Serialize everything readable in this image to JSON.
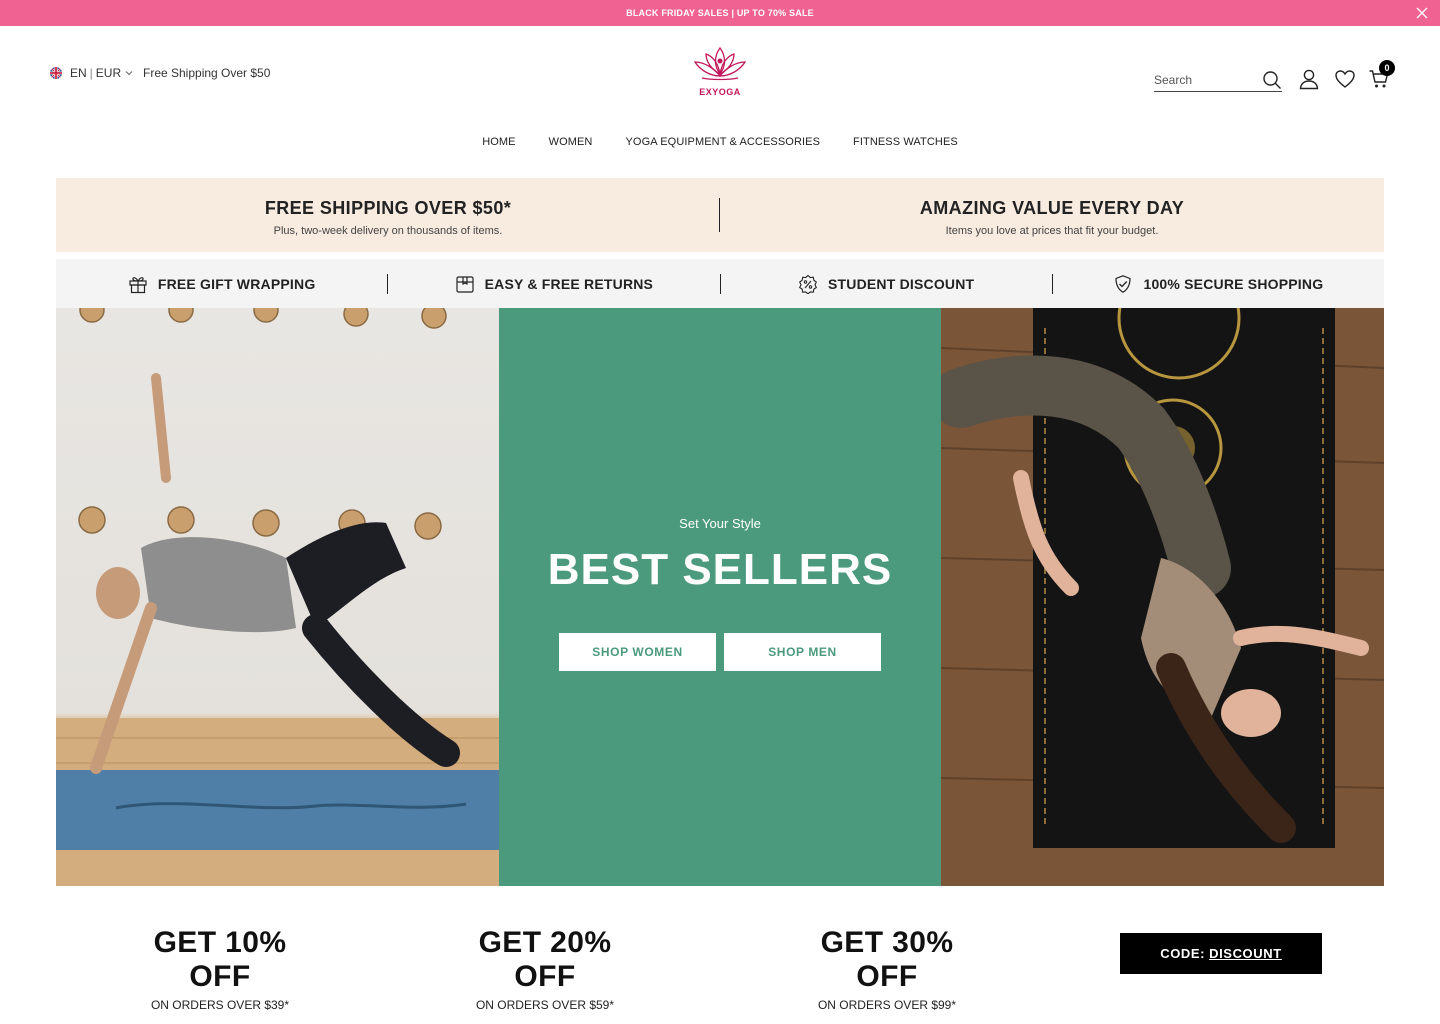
{
  "announcement": {
    "text": "BLACK FRIDAY SALES | UP TO 70% SALE"
  },
  "header": {
    "language": "EN",
    "currency": "EUR",
    "free_shipping": "Free Shipping Over $50",
    "logo_text": "EXYOGA",
    "search_placeholder": "Search",
    "cart_count": "0",
    "brand_color": "#c2185b"
  },
  "nav": {
    "items": [
      {
        "label": "HOME"
      },
      {
        "label": "WOMEN"
      },
      {
        "label": "YOGA EQUIPMENT & ACCESSORIES"
      },
      {
        "label": "FITNESS WATCHES"
      }
    ]
  },
  "promo": {
    "left": {
      "title": "FREE SHIPPING OVER $50*",
      "subtitle": "Plus, two-week delivery on thousands of items."
    },
    "right": {
      "title": "AMAZING VALUE EVERY DAY",
      "subtitle": "Items you love at prices that fit your budget."
    }
  },
  "features": [
    {
      "label": "FREE GIFT WRAPPING",
      "icon": "gift-icon"
    },
    {
      "label": "EASY & FREE RETURNS",
      "icon": "box-icon"
    },
    {
      "label": "STUDENT DISCOUNT",
      "icon": "percent-badge-icon"
    },
    {
      "label": "100% SECURE SHOPPING",
      "icon": "shield-check-icon"
    }
  ],
  "hero": {
    "kicker": "Set Your Style",
    "title": "BEST SELLERS",
    "buttons": [
      {
        "label": "SHOP WOMEN"
      },
      {
        "label": "SHOP MEN"
      }
    ],
    "accent_color": "#4b9a7e"
  },
  "discounts": [
    {
      "title": "GET 10% OFF",
      "subtitle": "ON ORDERS OVER $39*"
    },
    {
      "title": "GET 20% OFF",
      "subtitle": "ON ORDERS OVER $59*"
    },
    {
      "title": "GET 30% OFF",
      "subtitle": "ON ORDERS OVER $99*"
    }
  ],
  "code": {
    "label": "CODE:",
    "value": "DISCOUNT"
  }
}
